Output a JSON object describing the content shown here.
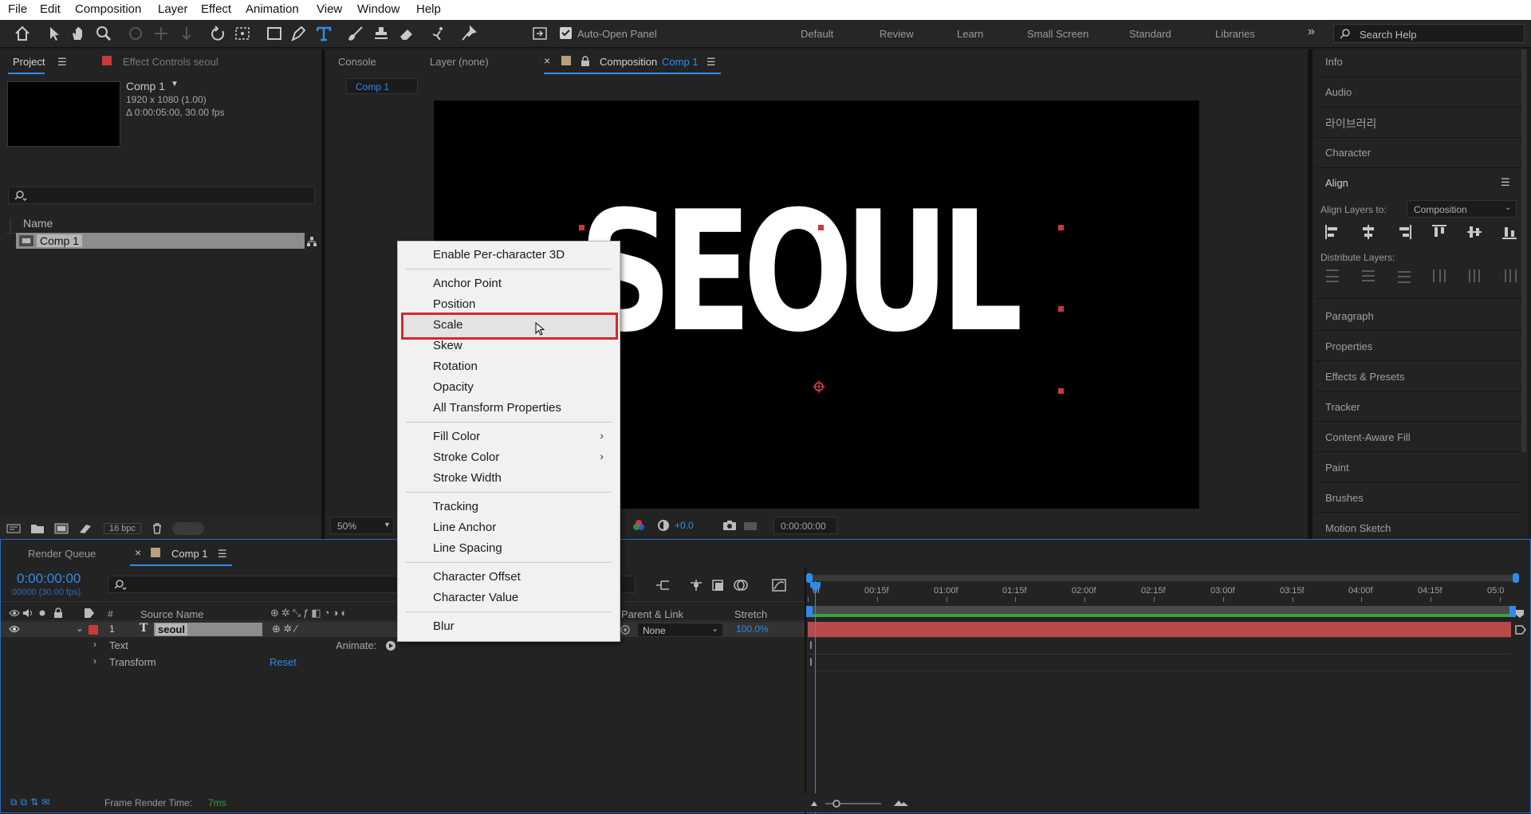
{
  "menu": [
    "File",
    "Edit",
    "Composition",
    "Layer",
    "Effect",
    "Animation",
    "View",
    "Window",
    "Help"
  ],
  "toolbar": {
    "auto_open_panel": "Auto-Open Panel",
    "workspaces": [
      "Default",
      "Review",
      "Learn",
      "Small Screen",
      "Standard",
      "Libraries"
    ],
    "search_help": "Search Help"
  },
  "project": {
    "tab": "Project",
    "effect_controls_tab": "Effect Controls seoul",
    "comp_name": "Comp 1",
    "comp_res": "1920 x 1080 (1.00)",
    "comp_duration": "Δ 0:00:05:00, 30.00 fps",
    "name_header": "Name",
    "item": "Comp 1",
    "bpc": "16 bpc"
  },
  "viewer": {
    "tab_console": "Console",
    "tab_layer": "Layer (none)",
    "tab_comp_label": "Composition",
    "tab_comp_name": "Comp 1",
    "comp_chip": "Comp 1",
    "canvas_text": "SEOUL",
    "zoom": "50%",
    "exposure": "+0.0",
    "timecode": "0:00:00:00"
  },
  "context_menu": {
    "items": [
      "Enable Per-character 3D",
      "Anchor Point",
      "Position",
      "Scale",
      "Skew",
      "Rotation",
      "Opacity",
      "All Transform Properties",
      "Fill Color",
      "Stroke Color",
      "Stroke Width",
      "Tracking",
      "Line Anchor",
      "Line Spacing",
      "Character Offset",
      "Character Value",
      "Blur"
    ],
    "highlighted": "Scale"
  },
  "right_panel": {
    "panels": [
      "Info",
      "Audio",
      "라이브러리",
      "Character",
      "Align",
      "Paragraph",
      "Properties",
      "Effects & Presets",
      "Tracker",
      "Content-Aware Fill",
      "Paint",
      "Brushes",
      "Motion Sketch"
    ],
    "align_layers_to_label": "Align Layers to:",
    "align_layers_to_value": "Composition",
    "distribute_label": "Distribute Layers:"
  },
  "timeline": {
    "tab_render_queue": "Render Queue",
    "tab_comp": "Comp 1",
    "timecode": "0:00:00:00",
    "frames": "00000 (30.00 fps)",
    "col_num": "#",
    "col_source": "Source Name",
    "col_parent": "Parent & Link",
    "col_stretch": "Stretch",
    "layer_number": "1",
    "layer_name": "seoul",
    "parent_value": "None",
    "stretch_value": "100.0%",
    "prop_text": "Text",
    "prop_transform": "Transform",
    "animate_label": "Animate:",
    "reset_label": "Reset",
    "ruler": [
      "0f",
      "00:15f",
      "01:00f",
      "01:15f",
      "02:00f",
      "02:15f",
      "03:00f",
      "03:15f",
      "04:00f",
      "04:15f",
      "05:0"
    ],
    "frame_render_label": "Frame Render Time:",
    "frame_render_value": "7ms"
  },
  "colors": {
    "accent": "#2d8ceb",
    "label_red": "#c83a3a",
    "highlight_box": "#d9262b",
    "bar_red": "#b84a4a"
  }
}
